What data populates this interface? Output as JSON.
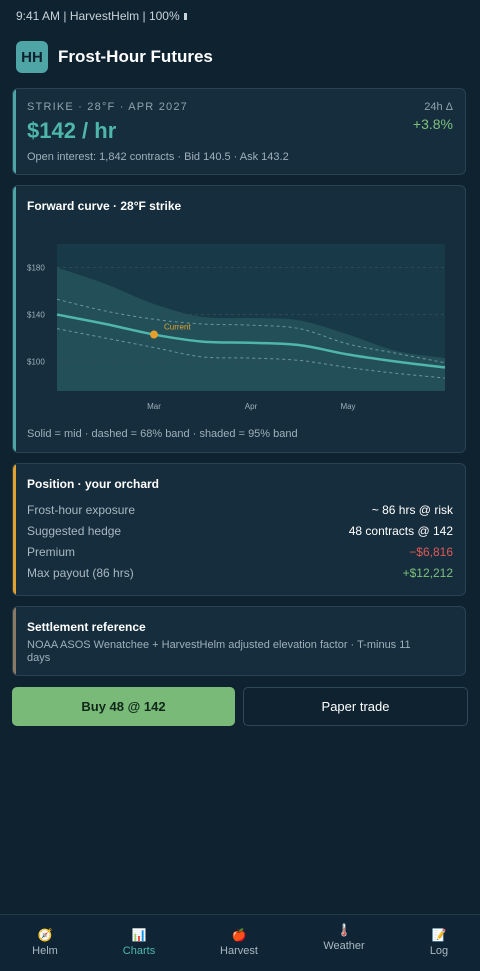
{
  "status_bar": {
    "text": "9:41 AM | HarvestHelm | 100%"
  },
  "app": {
    "logo": "HH",
    "title": "Frost-Hour Futures"
  },
  "strike": {
    "label": "STRIKE · 28°F · APR 2027",
    "price": "$142 / hr",
    "delta_label": "24h Δ",
    "delta_value": "+3.8%",
    "open_interest": "Open interest: 1,842 contracts · Bid 140.5 · Ask 143.2"
  },
  "forward_chart": {
    "title": "Forward curve · 28°F strike",
    "caption": "Solid = mid · dashed = 68% band · shaded = 95% band",
    "marker_label": "Current"
  },
  "chart_data": {
    "type": "line",
    "title": "Forward curve · 28°F strike",
    "x_ticks": [
      "Mar",
      "Apr",
      "May"
    ],
    "y_ticks": [
      100,
      140,
      180
    ],
    "ylim": [
      75,
      200
    ],
    "grid": true,
    "x": [
      0,
      0.5,
      1,
      1.5,
      2,
      2.5,
      3,
      3.5,
      4
    ],
    "series": [
      {
        "role": "mid",
        "style": "solid",
        "values": [
          140,
          132,
          123,
          117,
          116,
          114,
          106,
          100,
          95
        ]
      },
      {
        "role": "68% upper",
        "style": "dashed",
        "values": [
          153,
          143,
          136,
          132,
          131,
          128,
          115,
          107,
          99
        ]
      },
      {
        "role": "68% lower",
        "style": "dashed",
        "values": [
          128,
          120,
          112,
          104,
          103,
          101,
          95,
          90,
          86
        ]
      },
      {
        "role": "95% upper",
        "style": "shaded",
        "values": [
          180,
          166,
          149,
          138,
          137,
          135,
          123,
          109,
          103
        ]
      },
      {
        "role": "95% lower",
        "style": "shaded",
        "values": [
          75,
          75,
          75,
          75,
          75,
          75,
          75,
          75,
          75
        ]
      }
    ],
    "current_point": {
      "x": 1,
      "y": 123
    },
    "colors": {
      "mid": "#4fb6ad",
      "band": "#24505a",
      "current": "#e3a02b",
      "grid": "#2e4858"
    }
  },
  "position": {
    "title": "Position · your orchard",
    "rows": [
      {
        "label": "Frost-hour exposure",
        "value": "~ 86 hrs @ risk",
        "color": "#ffffff"
      },
      {
        "label": "Suggested hedge",
        "value": "48 contracts @ 142",
        "color": "#ffffff"
      },
      {
        "label": "Premium",
        "value": "−$6,816",
        "color": "#e05a56"
      },
      {
        "label": "Max payout (86 hrs)",
        "value": "+$12,212",
        "color": "#7ec07e"
      }
    ]
  },
  "settlement": {
    "title": "Settlement reference",
    "text": "NOAA ASOS Wenatchee + HarvestHelm adjusted elevation factor · T-minus 11 days"
  },
  "actions": {
    "buy": "Buy 48 @ 142",
    "paper": "Paper trade"
  },
  "tabs": [
    {
      "label": "Helm",
      "icon": "compass-icon",
      "glyph": "🧭"
    },
    {
      "label": "Charts",
      "icon": "bar-chart-icon",
      "glyph": "📊",
      "active": true
    },
    {
      "label": "Harvest",
      "icon": "apple-icon",
      "glyph": "🍎"
    },
    {
      "label": "Weather",
      "icon": "thermometer-icon",
      "glyph": "🌡️"
    },
    {
      "label": "Log",
      "icon": "memo-icon",
      "glyph": "📝"
    }
  ]
}
